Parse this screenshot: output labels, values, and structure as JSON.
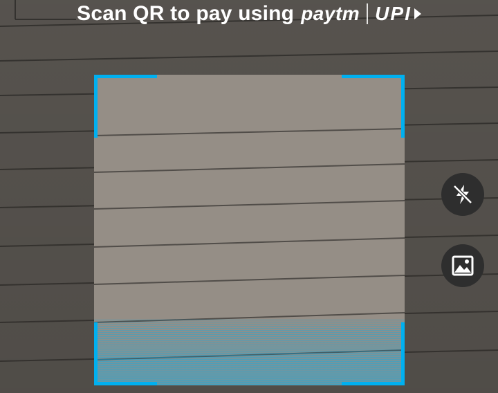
{
  "header": {
    "title": "Scan QR to pay using",
    "brand_primary": "paytm",
    "brand_secondary": "UPI"
  },
  "controls": {
    "flash_icon": "flash-off-icon",
    "gallery_icon": "gallery-icon"
  },
  "colors": {
    "scan_frame": "#00b0f0",
    "button_bg": "#2e2e2e",
    "text": "#ffffff"
  }
}
